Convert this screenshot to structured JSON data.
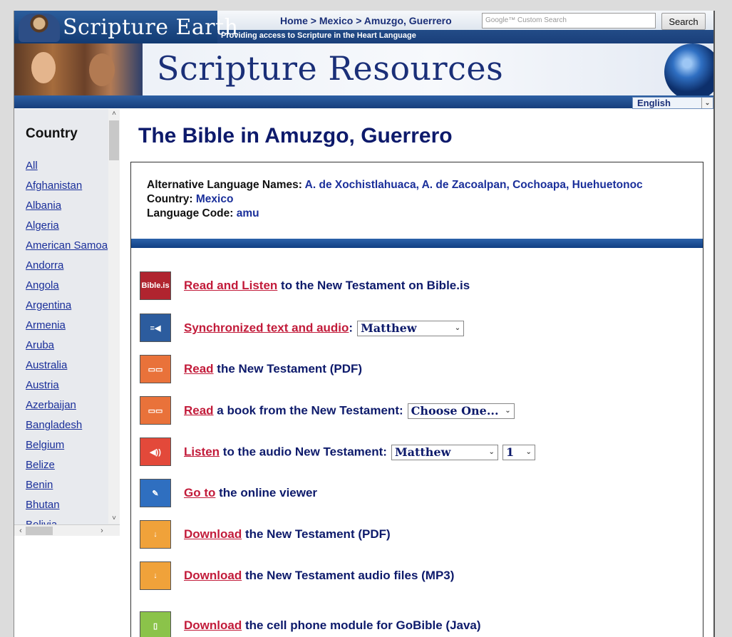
{
  "header": {
    "site_name": "Scripture Earth",
    "tagline": "Providing access to Scripture in the Heart Language",
    "breadcrumb": [
      "Home",
      "Mexico",
      "Amuzgo, Guerrero"
    ],
    "search_placeholder": "Google™ Custom Search",
    "search_button": "Search"
  },
  "banner": {
    "title": "Scripture Resources",
    "language_select": "English"
  },
  "sidebar": {
    "title": "Country",
    "countries": [
      "All",
      "Afghanistan",
      "Albania",
      "Algeria",
      "American Samoa",
      "Andorra",
      "Angola",
      "Argentina",
      "Armenia",
      "Aruba",
      "Australia",
      "Austria",
      "Azerbaijan",
      "Bangladesh",
      "Belgium",
      "Belize",
      "Benin",
      "Bhutan",
      "Bolivia"
    ]
  },
  "main": {
    "title": "The Bible in Amuzgo, Guerrero",
    "info": {
      "alt_label": "Alternative Language Names:",
      "alt_value": "A. de Xochistlahuaca, A. de Zacoalpan, Cochoapa, Huehuetonoc",
      "country_label": "Country:",
      "country_value": "Mexico",
      "code_label": "Language Code:",
      "code_value": "amu"
    },
    "resources": [
      {
        "icon": "bible-is-icon",
        "icon_text": "Bible.is",
        "link": "Read and Listen",
        "text": " to the New Testament on Bible.is"
      },
      {
        "icon": "sync-audio-icon",
        "link": "Synchronized text and audio",
        "text": ":",
        "select": "Matthew"
      },
      {
        "icon": "book-icon",
        "link": "Read",
        "text": " the New Testament (PDF)"
      },
      {
        "icon": "book-icon",
        "link": "Read",
        "text": " a book from the New Testament:",
        "select": "Choose One..."
      },
      {
        "icon": "speaker-icon",
        "link": "Listen",
        "text": " to the audio New Testament:",
        "select": "Matthew",
        "select2": "1"
      },
      {
        "icon": "edit-icon",
        "link": "Go to",
        "text": " the online viewer"
      },
      {
        "icon": "download-icon",
        "link": "Download",
        "text": " the New Testament (PDF)"
      },
      {
        "icon": "download-icon",
        "link": "Download",
        "text": " the New Testament audio files (MP3)"
      },
      {
        "icon": "phone-icon",
        "link": "Download",
        "text": " the cell phone module for GoBible (Java)"
      }
    ]
  }
}
